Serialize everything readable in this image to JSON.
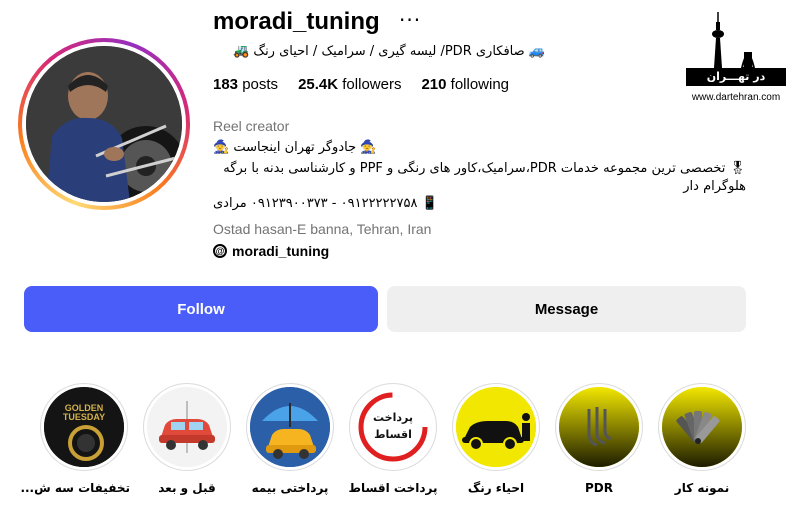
{
  "profile": {
    "username": "moradi_tuning",
    "more_label": "···",
    "tagline": "🚙 صافکاری PDR/ لیسه گیری / سرامیک / احیای رنگ 🚜",
    "stats": {
      "posts_count": "183",
      "posts_label": "posts",
      "followers_count": "25.4K",
      "followers_label": "followers",
      "following_count": "210",
      "following_label": "following"
    },
    "category": "Reel creator",
    "bio_line1": "🧙 جادوگر تهران اینجاست 🧙",
    "bio_line2": "🎖 تخصصی ترین مجموعه خدمات PDR،سرامیک،کاور های رنگی و PPF و کارشناسی بدنه با برگه هلوگرام دار",
    "bio_line3": "📱 ۰۹۱۲۲۲۲۲۷۵۸ - ۰۹۱۲۳۹۰۰۳۷۳ مرادی",
    "location": "Ostad hasan-E banna, Tehran, Iran",
    "threads_handle": "moradi_tuning"
  },
  "watermark": {
    "title": "در تهـــران",
    "url": "www.dartehran.com"
  },
  "actions": {
    "follow_label": "Follow",
    "message_label": "Message"
  },
  "highlights": [
    {
      "label": "تخفیفات سه ش...",
      "icon": "golden-tuesday-icon"
    },
    {
      "label": "قبل و بعد",
      "icon": "car-repair-icon"
    },
    {
      "label": "پرداختی بیمه",
      "icon": "insurance-umbrella-icon"
    },
    {
      "label": "پرداخت اقساط",
      "icon": "installment-stamp-icon",
      "text": "پرداخت اقساط"
    },
    {
      "label": "احیاء رنگ",
      "icon": "car-polish-icon"
    },
    {
      "label": "PDR",
      "icon": "pdr-tools-icon"
    },
    {
      "label": "نمونه کار",
      "icon": "color-palette-icon"
    }
  ],
  "colors": {
    "follow_button": "#4a5df9",
    "message_button": "#efefef",
    "muted_text": "#737373",
    "highlight_yellow": "#f2e700"
  }
}
